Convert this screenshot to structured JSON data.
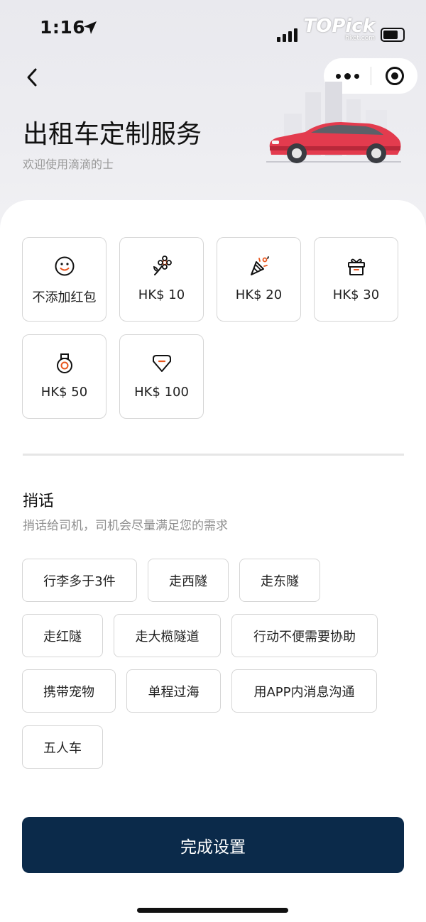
{
  "status_bar": {
    "time": "1:16",
    "watermark": "TOPick",
    "watermark_sub": "hket.com"
  },
  "header": {
    "title": "出租车定制服务",
    "subtitle": "欢迎使用滴滴的士"
  },
  "tips": [
    {
      "label": "不添加红包",
      "icon": "smile-icon"
    },
    {
      "label": "HK$ 10",
      "icon": "flower-icon"
    },
    {
      "label": "HK$ 20",
      "icon": "party-popper-icon"
    },
    {
      "label": "HK$ 30",
      "icon": "gift-icon"
    },
    {
      "label": "HK$ 50",
      "icon": "medal-icon"
    },
    {
      "label": "HK$ 100",
      "icon": "diamond-icon"
    }
  ],
  "message": {
    "title": "捎话",
    "subtitle": "捎话给司机，司机会尽量满足您的需求",
    "options": [
      "行李多于3件",
      "走西隧",
      "走东隧",
      "走红隧",
      "走大榄隧道",
      "行动不便需要协助",
      "携带宠物",
      "单程过海",
      "用APP内消息沟通",
      "五人车"
    ]
  },
  "actions": {
    "done_label": "完成设置"
  },
  "colors": {
    "primary": "#0b2a4a",
    "accent": "#e8561e",
    "border": "#d5d5d5"
  }
}
